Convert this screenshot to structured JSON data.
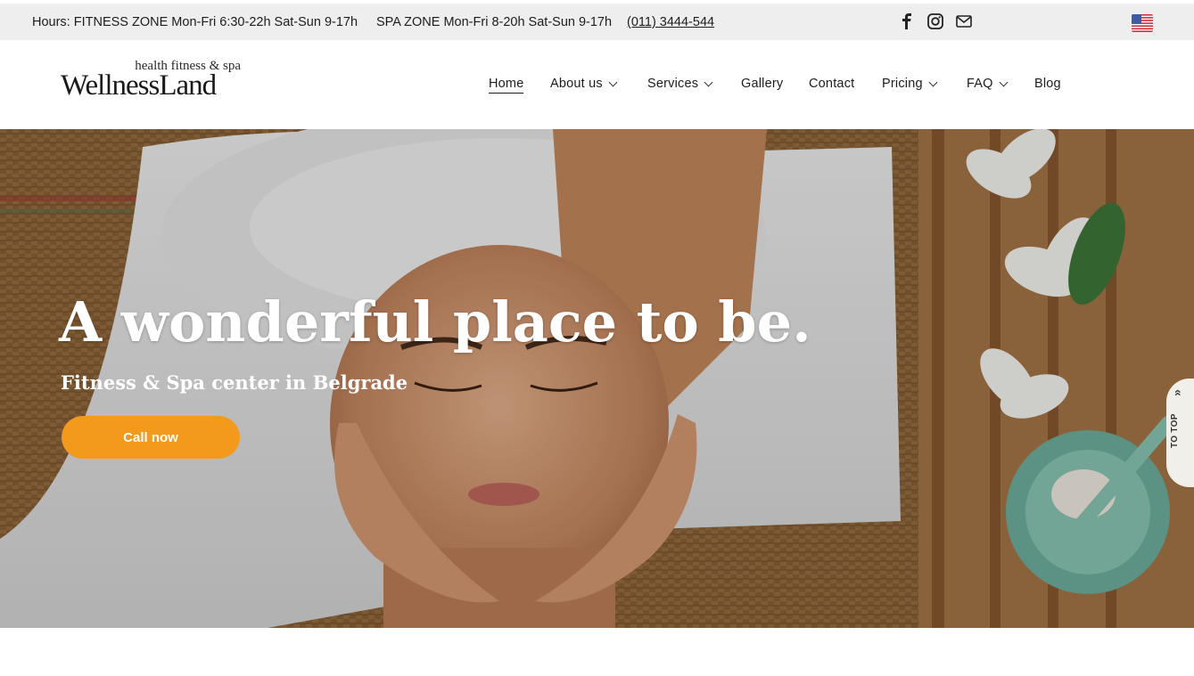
{
  "topbar": {
    "hours": "Hours: FITNESS ZONE Mon-Fri 6:30-22h Sat-Sun 9-17h",
    "spa": "SPA ZONE Mon-Fri 8-20h Sat-Sun 9-17h",
    "phone": "(011) 3444-544 ",
    "social_icons": [
      "facebook-icon",
      "instagram-icon",
      "mail-icon"
    ],
    "language_flag": "us-flag-icon"
  },
  "logo": {
    "tagline": "health fitness & spa",
    "brand": "WellnessLand"
  },
  "nav": {
    "items": [
      {
        "label": "Home",
        "active": true,
        "dropdown": false
      },
      {
        "label": "About us",
        "active": false,
        "dropdown": true
      },
      {
        "label": "Services",
        "active": false,
        "dropdown": true
      },
      {
        "label": "Gallery",
        "active": false,
        "dropdown": false
      },
      {
        "label": "Contact",
        "active": false,
        "dropdown": false
      },
      {
        "label": "Pricing",
        "active": false,
        "dropdown": true
      },
      {
        "label": "FAQ",
        "active": false,
        "dropdown": true
      },
      {
        "label": "Blog",
        "active": false,
        "dropdown": false
      }
    ]
  },
  "hero": {
    "title": "A wonderful place to be.",
    "subtitle": "Fitness & Spa center in Belgrade",
    "cta_label": "Call now"
  },
  "to_top": {
    "label": "TO TOP",
    "icon": "double-chevron-up-icon"
  },
  "colors": {
    "accent": "#f39a1c",
    "topbar_bg": "#eeeeee"
  }
}
